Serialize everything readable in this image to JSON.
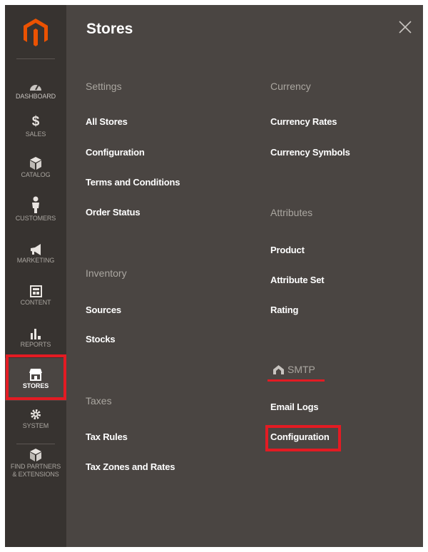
{
  "sidebar": {
    "items": [
      {
        "label": "DASHBOARD",
        "icon": "dashboard-icon"
      },
      {
        "label": "$",
        "sub": "SALES",
        "icon": "dollar-icon"
      },
      {
        "label": "CATALOG",
        "icon": "catalog-icon"
      },
      {
        "label": "CUSTOMERS",
        "icon": "customers-icon"
      },
      {
        "label": "MARKETING",
        "icon": "megaphone-icon"
      },
      {
        "label": "CONTENT",
        "icon": "content-icon"
      },
      {
        "label": "REPORTS",
        "icon": "reports-icon"
      },
      {
        "label": "STORES",
        "icon": "stores-icon"
      },
      {
        "label": "SYSTEM",
        "icon": "gear-icon"
      },
      {
        "label": "FIND PARTNERS & EXTENSIONS",
        "label1": "FIND PARTNERS",
        "label2": "& EXTENSIONS",
        "icon": "extensions-icon"
      }
    ]
  },
  "panel": {
    "title": "Stores",
    "settings": {
      "heading": "Settings",
      "links": [
        "All Stores",
        "Configuration",
        "Terms and Conditions",
        "Order Status"
      ]
    },
    "inventory": {
      "heading": "Inventory",
      "links": [
        "Sources",
        "Stocks"
      ]
    },
    "taxes": {
      "heading": "Taxes",
      "links": [
        "Tax Rules",
        "Tax Zones and Rates"
      ]
    },
    "currency": {
      "heading": "Currency",
      "links": [
        "Currency Rates",
        "Currency Symbols"
      ]
    },
    "attributes": {
      "heading": "Attributes",
      "links": [
        "Product",
        "Attribute Set",
        "Rating"
      ]
    },
    "smtp": {
      "heading": "SMTP",
      "links": [
        "Email Logs",
        "Configuration"
      ]
    }
  },
  "colors": {
    "sidebar_bg": "#373330",
    "panel_bg": "#4a4542",
    "brand_orange": "#eb5202",
    "highlight_red": "#e31b23"
  }
}
